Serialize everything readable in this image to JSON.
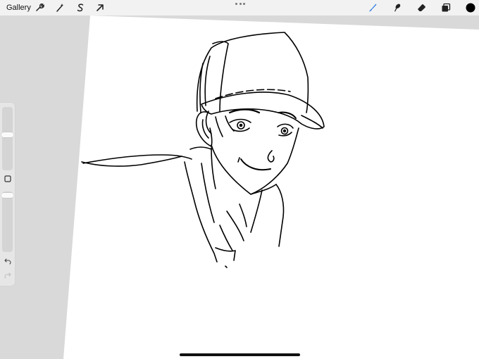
{
  "toolbar": {
    "gallery_label": "Gallery",
    "left_tools": [
      {
        "name": "actions",
        "icon": "wrench-icon"
      },
      {
        "name": "adjustments",
        "icon": "magic-wand-icon"
      },
      {
        "name": "selection",
        "icon": "selection-s-icon"
      },
      {
        "name": "transform",
        "icon": "arrow-cursor-icon"
      }
    ],
    "right_tools": [
      {
        "name": "brush",
        "icon": "brush-icon",
        "active": true
      },
      {
        "name": "smudge",
        "icon": "smudge-icon"
      },
      {
        "name": "eraser",
        "icon": "eraser-icon"
      },
      {
        "name": "layers",
        "icon": "layers-icon"
      },
      {
        "name": "color",
        "icon": "color-swatch"
      }
    ],
    "accent_color": "#2f7de1",
    "current_color": "#000000"
  },
  "sidebar": {
    "brush_size_level": 0.18,
    "opacity_level": 0.0,
    "modify_button_icon": "square-icon",
    "undo_icon": "undo-icon",
    "redo_icon": "redo-icon"
  },
  "canvas": {
    "background": "#ffffff",
    "stroke_color": "#000000",
    "drawing": "line-art-sketch-boy-in-baseball-cap"
  }
}
